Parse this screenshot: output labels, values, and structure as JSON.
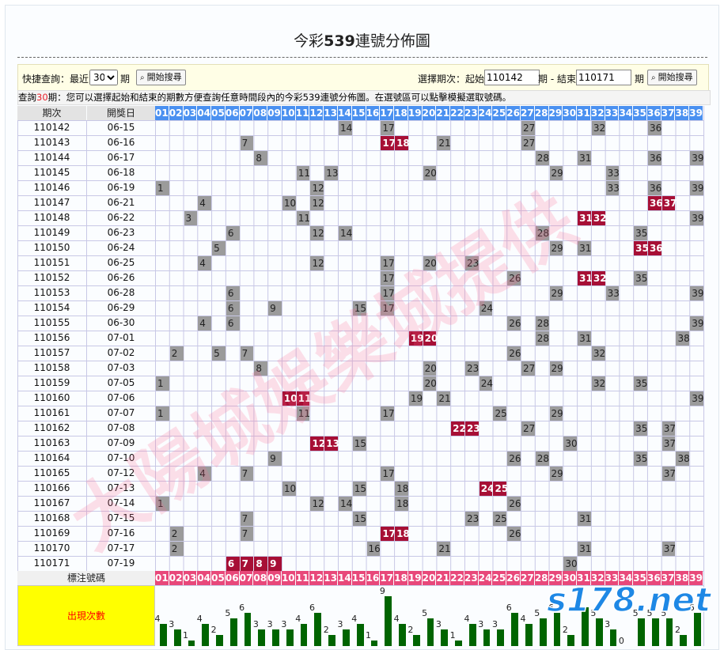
{
  "title": {
    "prefix": "今彩",
    "bold": "539",
    "suffix": "連號分佈圖"
  },
  "query": {
    "quick_label": "快捷查詢：最近",
    "recent_value": "30",
    "recent_options": [
      "30"
    ],
    "period_unit": "期",
    "search_button": "開始搜尋",
    "range_label": "選擇期次：起始",
    "start_value": "110142",
    "range_mid": "期 - 結束",
    "end_value": "110171",
    "range_unit": "期"
  },
  "note": {
    "prefix": "查詢",
    "count": "30",
    "suffix": "期：您可以選擇起始和結束的期數方便查詢任意時間段內的今彩539連號分佈圖。在選號區可以點擊模擬選取號碼。"
  },
  "headers": {
    "period": "期次",
    "date": "開獎日"
  },
  "numbers": [
    "01",
    "02",
    "03",
    "04",
    "05",
    "06",
    "07",
    "08",
    "09",
    "10",
    "11",
    "12",
    "13",
    "14",
    "15",
    "16",
    "17",
    "18",
    "19",
    "20",
    "21",
    "22",
    "23",
    "24",
    "25",
    "26",
    "27",
    "28",
    "29",
    "30",
    "31",
    "32",
    "33",
    "34",
    "35",
    "36",
    "37",
    "38",
    "39"
  ],
  "rows": [
    {
      "period": "110142",
      "date": "06-15",
      "nums": [
        14,
        17,
        27,
        32,
        36
      ],
      "consec": []
    },
    {
      "period": "110143",
      "date": "06-16",
      "nums": [
        7,
        17,
        18,
        21,
        27
      ],
      "consec": [
        17,
        18
      ]
    },
    {
      "period": "110144",
      "date": "06-17",
      "nums": [
        8,
        28,
        31,
        36,
        39
      ],
      "consec": []
    },
    {
      "period": "110145",
      "date": "06-18",
      "nums": [
        11,
        13,
        20,
        29,
        33
      ],
      "consec": []
    },
    {
      "period": "110146",
      "date": "06-19",
      "nums": [
        1,
        12,
        33,
        36,
        39
      ],
      "consec": []
    },
    {
      "period": "110147",
      "date": "06-21",
      "nums": [
        4,
        10,
        12,
        36,
        37
      ],
      "consec": [
        36,
        37
      ]
    },
    {
      "period": "110148",
      "date": "06-22",
      "nums": [
        3,
        11,
        31,
        32,
        39
      ],
      "consec": [
        31,
        32
      ]
    },
    {
      "period": "110149",
      "date": "06-23",
      "nums": [
        6,
        12,
        14,
        28,
        35
      ],
      "consec": []
    },
    {
      "period": "110150",
      "date": "06-24",
      "nums": [
        5,
        29,
        31,
        35,
        36
      ],
      "consec": [
        35,
        36
      ]
    },
    {
      "period": "110151",
      "date": "06-25",
      "nums": [
        4,
        12,
        17,
        20,
        23
      ],
      "consec": []
    },
    {
      "period": "110152",
      "date": "06-26",
      "nums": [
        17,
        26,
        31,
        32,
        35
      ],
      "consec": [
        31,
        32
      ]
    },
    {
      "period": "110153",
      "date": "06-28",
      "nums": [
        6,
        17,
        29,
        33,
        39
      ],
      "consec": []
    },
    {
      "period": "110154",
      "date": "06-29",
      "nums": [
        6,
        9,
        15,
        17,
        24
      ],
      "consec": []
    },
    {
      "period": "110155",
      "date": "06-30",
      "nums": [
        4,
        6,
        26,
        28,
        39
      ],
      "consec": []
    },
    {
      "period": "110156",
      "date": "07-01",
      "nums": [
        19,
        20,
        28,
        31,
        38
      ],
      "consec": [
        19,
        20
      ]
    },
    {
      "period": "110157",
      "date": "07-02",
      "nums": [
        2,
        5,
        7,
        26,
        32
      ],
      "consec": []
    },
    {
      "period": "110158",
      "date": "07-03",
      "nums": [
        8,
        20,
        23,
        27,
        29
      ],
      "consec": []
    },
    {
      "period": "110159",
      "date": "07-05",
      "nums": [
        1,
        20,
        24,
        32,
        35
      ],
      "consec": []
    },
    {
      "period": "110160",
      "date": "07-06",
      "nums": [
        10,
        11,
        19,
        21,
        39
      ],
      "consec": [
        10,
        11
      ]
    },
    {
      "period": "110161",
      "date": "07-07",
      "nums": [
        1,
        11,
        17,
        25,
        29
      ],
      "consec": []
    },
    {
      "period": "110162",
      "date": "07-08",
      "nums": [
        22,
        23,
        27,
        35,
        37
      ],
      "consec": [
        22,
        23
      ]
    },
    {
      "period": "110163",
      "date": "07-09",
      "nums": [
        12,
        13,
        15,
        30,
        37
      ],
      "consec": [
        12,
        13
      ]
    },
    {
      "period": "110164",
      "date": "07-10",
      "nums": [
        9,
        26,
        28,
        35,
        38
      ],
      "consec": []
    },
    {
      "period": "110165",
      "date": "07-12",
      "nums": [
        4,
        7,
        17,
        29,
        37
      ],
      "consec": []
    },
    {
      "period": "110166",
      "date": "07-13",
      "nums": [
        10,
        15,
        18,
        24,
        25
      ],
      "consec": [
        24,
        25
      ]
    },
    {
      "period": "110167",
      "date": "07-14",
      "nums": [
        1,
        12,
        14,
        18,
        26
      ],
      "consec": []
    },
    {
      "period": "110168",
      "date": "07-15",
      "nums": [
        7,
        15,
        23,
        25,
        31
      ],
      "consec": []
    },
    {
      "period": "110169",
      "date": "07-16",
      "nums": [
        2,
        7,
        17,
        18,
        26
      ],
      "consec": [
        17,
        18
      ]
    },
    {
      "period": "110170",
      "date": "07-17",
      "nums": [
        2,
        16,
        21,
        31,
        37
      ],
      "consec": []
    },
    {
      "period": "110171",
      "date": "07-19",
      "nums": [
        6,
        7,
        8,
        9,
        30
      ],
      "consec": [
        6,
        7,
        8,
        9
      ]
    }
  ],
  "marker_label": "標注號碼",
  "count_label": "出現次數",
  "counts": [
    4,
    3,
    1,
    4,
    2,
    5,
    6,
    3,
    3,
    3,
    4,
    6,
    2,
    3,
    4,
    1,
    9,
    4,
    2,
    5,
    3,
    1,
    4,
    3,
    3,
    6,
    4,
    5,
    6,
    2,
    7,
    5,
    3,
    0,
    5,
    5,
    5,
    2,
    6
  ],
  "watermark": "大陽城娛樂城提供",
  "logo": "s178.net",
  "colors": {
    "number_header": "#4a90f0",
    "consecutive": "#a70f35",
    "drawn": "#9b9b9b",
    "marker_row": "#e8487a",
    "count_bg": "#ffff00",
    "bar": "#006400"
  }
}
